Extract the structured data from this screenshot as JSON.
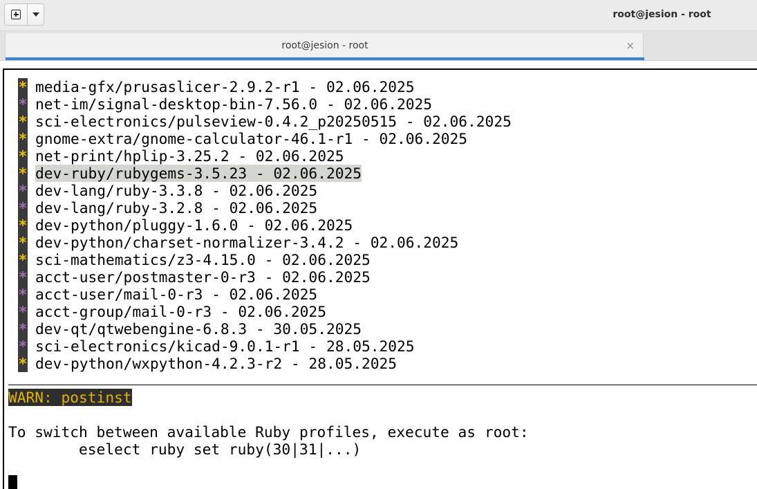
{
  "window": {
    "title": "root@jesion - root"
  },
  "tab": {
    "label": "root@jesion - root",
    "close_glyph": "×"
  },
  "packages": [
    {
      "star": "*",
      "color": "#e8c000",
      "text": "media-gfx/prusaslicer-2.9.2-r1 - 02.06.2025",
      "highlighted": false
    },
    {
      "star": "*",
      "color": "#a070b0",
      "text": "net-im/signal-desktop-bin-7.56.0 - 02.06.2025",
      "highlighted": false
    },
    {
      "star": "*",
      "color": "#e8c000",
      "text": "sci-electronics/pulseview-0.4.2_p20250515 - 02.06.2025",
      "highlighted": false
    },
    {
      "star": "*",
      "color": "#e8c000",
      "text": "gnome-extra/gnome-calculator-46.1-r1 - 02.06.2025",
      "highlighted": false
    },
    {
      "star": "*",
      "color": "#e8c000",
      "text": "net-print/hplip-3.25.2 - 02.06.2025",
      "highlighted": false
    },
    {
      "star": "*",
      "color": "#e8c000",
      "text": "dev-ruby/rubygems-3.5.23 - 02.06.2025",
      "highlighted": true
    },
    {
      "star": "*",
      "color": "#a070b0",
      "text": "dev-lang/ruby-3.3.8 - 02.06.2025",
      "highlighted": false
    },
    {
      "star": "*",
      "color": "#a070b0",
      "text": "dev-lang/ruby-3.2.8 - 02.06.2025",
      "highlighted": false
    },
    {
      "star": "*",
      "color": "#e8c000",
      "text": "dev-python/pluggy-1.6.0 - 02.06.2025",
      "highlighted": false
    },
    {
      "star": "*",
      "color": "#e8c000",
      "text": "dev-python/charset-normalizer-3.4.2 - 02.06.2025",
      "highlighted": false
    },
    {
      "star": "*",
      "color": "#e8c000",
      "text": "sci-mathematics/z3-4.15.0 - 02.06.2025",
      "highlighted": false
    },
    {
      "star": "*",
      "color": "#a070b0",
      "text": "acct-user/postmaster-0-r3 - 02.06.2025",
      "highlighted": false
    },
    {
      "star": "*",
      "color": "#a070b0",
      "text": "acct-user/mail-0-r3 - 02.06.2025",
      "highlighted": false
    },
    {
      "star": "*",
      "color": "#a070b0",
      "text": "acct-group/mail-0-r3 - 02.06.2025",
      "highlighted": false
    },
    {
      "star": "*",
      "color": "#a070b0",
      "text": "dev-qt/qtwebengine-6.8.3 - 30.05.2025",
      "highlighted": false
    },
    {
      "star": "*",
      "color": "#a070b0",
      "text": "sci-electronics/kicad-9.0.1-r1 - 28.05.2025",
      "highlighted": false
    },
    {
      "star": "*",
      "color": "#e8c000",
      "text": "dev-python/wxpython-4.2.3-r2 - 28.05.2025",
      "highlighted": false
    }
  ],
  "warning": {
    "text": "WARN: postinst",
    "color": "#e0b300"
  },
  "message": {
    "line1": "To switch between available Ruby profiles, execute as root:",
    "line2": "        eselect ruby set ruby(30|31|...)"
  }
}
